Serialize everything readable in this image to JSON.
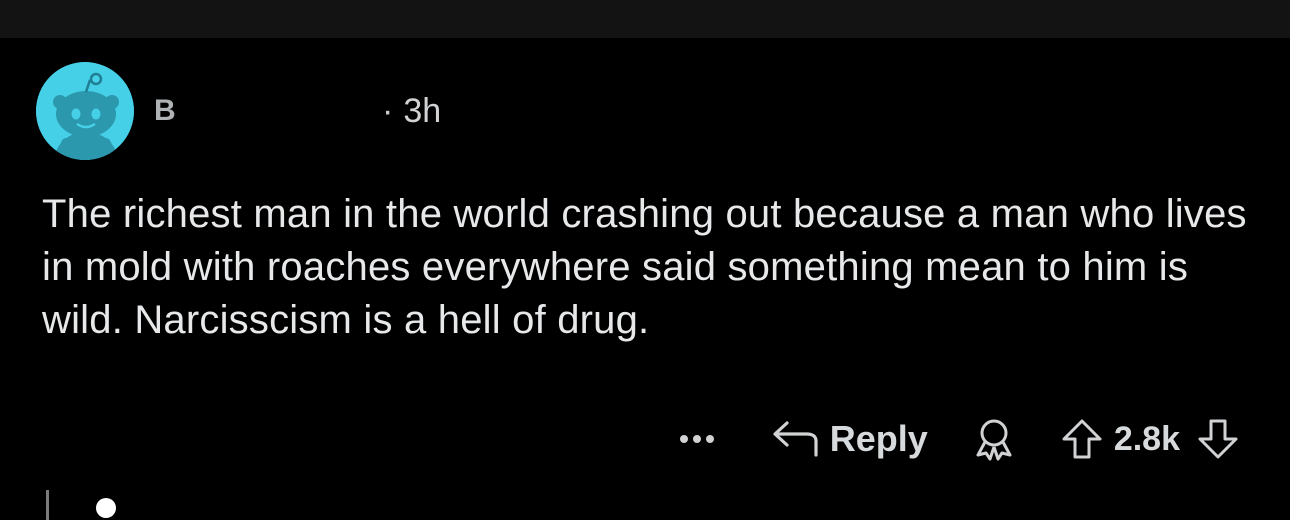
{
  "comment": {
    "username": "B",
    "separator": "·",
    "time": "3h",
    "body": "The richest man in the world crashing out because a man who lives in mold with roaches everywhere said something mean to him is wild. Narcisscism is a hell of drug.",
    "avatar_icon": "snoo-avatar-icon",
    "avatar_color": "#46d0e8"
  },
  "actions": {
    "more_icon": "more-dots-icon",
    "reply_label": "Reply",
    "score": "2.8k"
  }
}
